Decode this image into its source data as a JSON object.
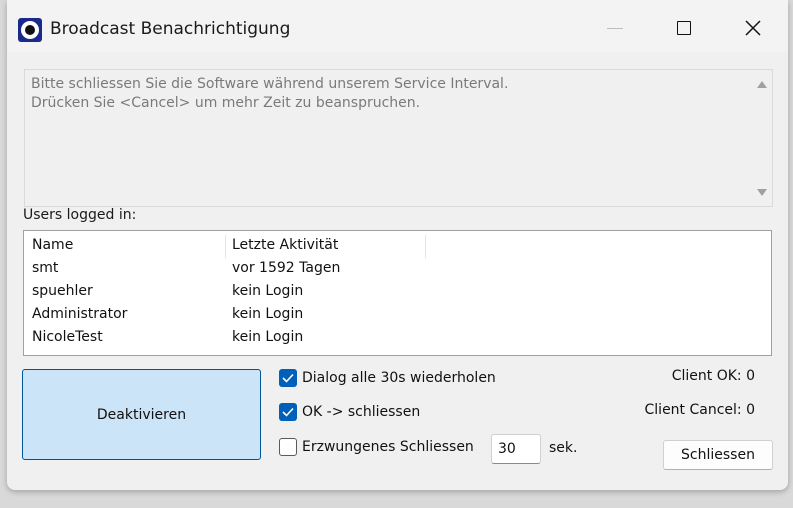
{
  "window": {
    "title": "Broadcast Benachrichtigung"
  },
  "message": {
    "text": "Bitte schliessen Sie die Software während unserem Service Interval.\nDrücken Sie <Cancel> um mehr Zeit zu beanspruchen."
  },
  "users": {
    "label": "Users logged in:",
    "columns": [
      "Name",
      "Letzte Aktivität"
    ],
    "rows": [
      [
        "smt",
        "vor 1592 Tagen"
      ],
      [
        "spuehler",
        "kein Login"
      ],
      [
        "Administrator",
        "kein Login"
      ],
      [
        "NicoleTest",
        "kein Login"
      ]
    ]
  },
  "controls": {
    "deactivate_label": "Deaktivieren",
    "repeat_label": "Dialog alle 30s wiederholen",
    "repeat_checked": true,
    "ok_close_label": "OK -> schliessen",
    "ok_close_checked": true,
    "forced_close_label": "Erzwungenes Schliessen",
    "forced_close_checked": false,
    "seconds_value": "30",
    "seconds_unit": "sek.",
    "close_label": "Schliessen"
  },
  "status": {
    "client_ok": "Client OK: 0",
    "client_cancel": "Client Cancel: 0"
  },
  "colors": {
    "accent": "#005fb8",
    "button_highlight": "#cce4f7"
  }
}
